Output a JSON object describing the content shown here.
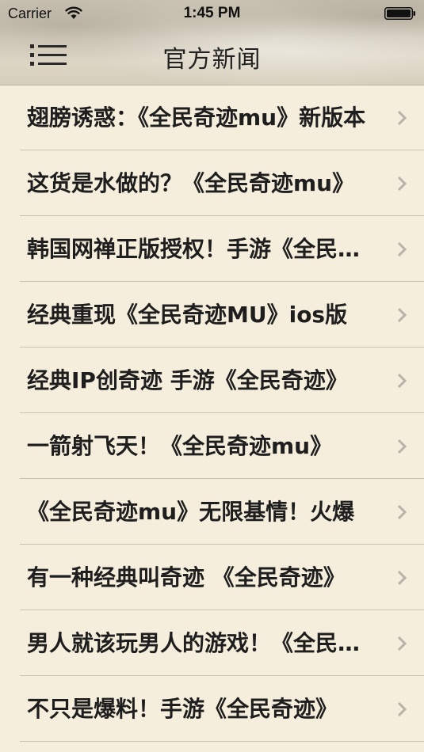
{
  "status_bar": {
    "carrier": "Carrier",
    "time": "1:45 PM"
  },
  "nav": {
    "title": "官方新闻",
    "menu_icon": "menu-list-icon"
  },
  "news": [
    {
      "title": "翅膀诱惑：《全民奇迹mu》新版本"
    },
    {
      "title": "这货是水做的？《全民奇迹mu》"
    },
    {
      "title": "韩国网禅正版授权！手游《全民奇迹》"
    },
    {
      "title": "经典重现《全民奇迹MU》ios版"
    },
    {
      "title": "经典IP创奇迹 手游《全民奇迹》"
    },
    {
      "title": "一箭射飞天！《全民奇迹mu》"
    },
    {
      "title": "《全民奇迹mu》无限基情！火爆"
    },
    {
      "title": "有一种经典叫奇迹 《全民奇迹》"
    },
    {
      "title": "男人就该玩男人的游戏！《全民奇迹》"
    },
    {
      "title": "不只是爆料！手游《全民奇迹》"
    }
  ],
  "colors": {
    "background": "#f6eedc",
    "separator": "#c9c2b3",
    "chevron": "#b8b2a8"
  }
}
